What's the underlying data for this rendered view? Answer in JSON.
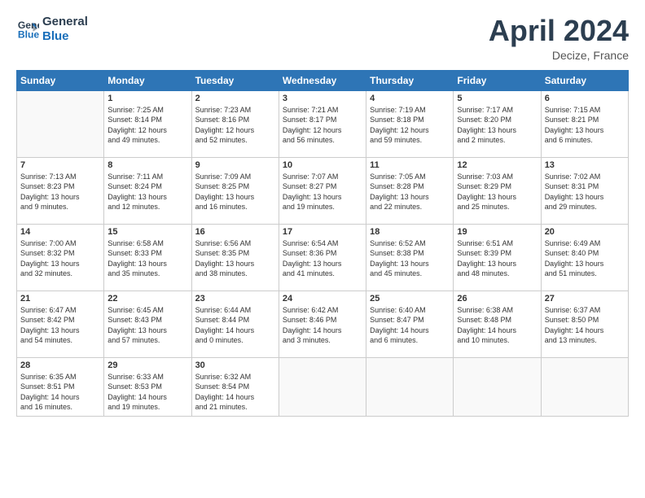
{
  "logo": {
    "line1": "General",
    "line2": "Blue"
  },
  "title": "April 2024",
  "location": "Decize, France",
  "days_of_week": [
    "Sunday",
    "Monday",
    "Tuesday",
    "Wednesday",
    "Thursday",
    "Friday",
    "Saturday"
  ],
  "weeks": [
    [
      {
        "num": "",
        "info": ""
      },
      {
        "num": "1",
        "info": "Sunrise: 7:25 AM\nSunset: 8:14 PM\nDaylight: 12 hours\nand 49 minutes."
      },
      {
        "num": "2",
        "info": "Sunrise: 7:23 AM\nSunset: 8:16 PM\nDaylight: 12 hours\nand 52 minutes."
      },
      {
        "num": "3",
        "info": "Sunrise: 7:21 AM\nSunset: 8:17 PM\nDaylight: 12 hours\nand 56 minutes."
      },
      {
        "num": "4",
        "info": "Sunrise: 7:19 AM\nSunset: 8:18 PM\nDaylight: 12 hours\nand 59 minutes."
      },
      {
        "num": "5",
        "info": "Sunrise: 7:17 AM\nSunset: 8:20 PM\nDaylight: 13 hours\nand 2 minutes."
      },
      {
        "num": "6",
        "info": "Sunrise: 7:15 AM\nSunset: 8:21 PM\nDaylight: 13 hours\nand 6 minutes."
      }
    ],
    [
      {
        "num": "7",
        "info": "Sunrise: 7:13 AM\nSunset: 8:23 PM\nDaylight: 13 hours\nand 9 minutes."
      },
      {
        "num": "8",
        "info": "Sunrise: 7:11 AM\nSunset: 8:24 PM\nDaylight: 13 hours\nand 12 minutes."
      },
      {
        "num": "9",
        "info": "Sunrise: 7:09 AM\nSunset: 8:25 PM\nDaylight: 13 hours\nand 16 minutes."
      },
      {
        "num": "10",
        "info": "Sunrise: 7:07 AM\nSunset: 8:27 PM\nDaylight: 13 hours\nand 19 minutes."
      },
      {
        "num": "11",
        "info": "Sunrise: 7:05 AM\nSunset: 8:28 PM\nDaylight: 13 hours\nand 22 minutes."
      },
      {
        "num": "12",
        "info": "Sunrise: 7:03 AM\nSunset: 8:29 PM\nDaylight: 13 hours\nand 25 minutes."
      },
      {
        "num": "13",
        "info": "Sunrise: 7:02 AM\nSunset: 8:31 PM\nDaylight: 13 hours\nand 29 minutes."
      }
    ],
    [
      {
        "num": "14",
        "info": "Sunrise: 7:00 AM\nSunset: 8:32 PM\nDaylight: 13 hours\nand 32 minutes."
      },
      {
        "num": "15",
        "info": "Sunrise: 6:58 AM\nSunset: 8:33 PM\nDaylight: 13 hours\nand 35 minutes."
      },
      {
        "num": "16",
        "info": "Sunrise: 6:56 AM\nSunset: 8:35 PM\nDaylight: 13 hours\nand 38 minutes."
      },
      {
        "num": "17",
        "info": "Sunrise: 6:54 AM\nSunset: 8:36 PM\nDaylight: 13 hours\nand 41 minutes."
      },
      {
        "num": "18",
        "info": "Sunrise: 6:52 AM\nSunset: 8:38 PM\nDaylight: 13 hours\nand 45 minutes."
      },
      {
        "num": "19",
        "info": "Sunrise: 6:51 AM\nSunset: 8:39 PM\nDaylight: 13 hours\nand 48 minutes."
      },
      {
        "num": "20",
        "info": "Sunrise: 6:49 AM\nSunset: 8:40 PM\nDaylight: 13 hours\nand 51 minutes."
      }
    ],
    [
      {
        "num": "21",
        "info": "Sunrise: 6:47 AM\nSunset: 8:42 PM\nDaylight: 13 hours\nand 54 minutes."
      },
      {
        "num": "22",
        "info": "Sunrise: 6:45 AM\nSunset: 8:43 PM\nDaylight: 13 hours\nand 57 minutes."
      },
      {
        "num": "23",
        "info": "Sunrise: 6:44 AM\nSunset: 8:44 PM\nDaylight: 14 hours\nand 0 minutes."
      },
      {
        "num": "24",
        "info": "Sunrise: 6:42 AM\nSunset: 8:46 PM\nDaylight: 14 hours\nand 3 minutes."
      },
      {
        "num": "25",
        "info": "Sunrise: 6:40 AM\nSunset: 8:47 PM\nDaylight: 14 hours\nand 6 minutes."
      },
      {
        "num": "26",
        "info": "Sunrise: 6:38 AM\nSunset: 8:48 PM\nDaylight: 14 hours\nand 10 minutes."
      },
      {
        "num": "27",
        "info": "Sunrise: 6:37 AM\nSunset: 8:50 PM\nDaylight: 14 hours\nand 13 minutes."
      }
    ],
    [
      {
        "num": "28",
        "info": "Sunrise: 6:35 AM\nSunset: 8:51 PM\nDaylight: 14 hours\nand 16 minutes."
      },
      {
        "num": "29",
        "info": "Sunrise: 6:33 AM\nSunset: 8:53 PM\nDaylight: 14 hours\nand 19 minutes."
      },
      {
        "num": "30",
        "info": "Sunrise: 6:32 AM\nSunset: 8:54 PM\nDaylight: 14 hours\nand 21 minutes."
      },
      {
        "num": "",
        "info": ""
      },
      {
        "num": "",
        "info": ""
      },
      {
        "num": "",
        "info": ""
      },
      {
        "num": "",
        "info": ""
      }
    ]
  ]
}
